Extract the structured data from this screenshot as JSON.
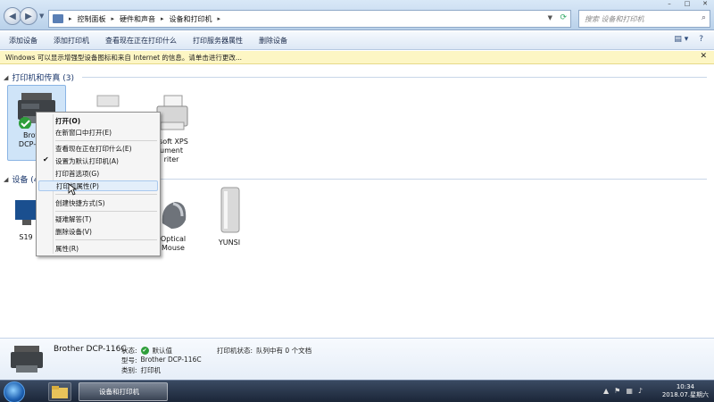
{
  "breadcrumb": [
    "控制面板",
    "硬件和声音",
    "设备和打印机"
  ],
  "search": {
    "placeholder": "搜索 设备和打印机"
  },
  "toolbar": [
    "添加设备",
    "添加打印机",
    "查看现在正在打印什么",
    "打印服务器属性",
    "删除设备"
  ],
  "infobar": {
    "text": "Windows 可以显示增强型设备图标和来自 Internet 的信息。请单击进行更改..."
  },
  "groups": {
    "printers": "打印机和传真 (3)",
    "devices": "设备 (4)"
  },
  "printers": [
    {
      "label_1": "Brother",
      "label_2": "DCP-116C"
    },
    {
      "label_1": "",
      "label_2": ""
    },
    {
      "label_1": "osoft XPS",
      "label_2": "ument",
      "label_3": "riter"
    }
  ],
  "devices": [
    {
      "label": "S19"
    },
    {
      "label_1": "Optical",
      "label_2": "Mouse"
    },
    {
      "label": "YUNSI"
    }
  ],
  "context_menu": [
    {
      "label": "打开(O)",
      "bold": true
    },
    {
      "label": "在新窗口中打开(E)"
    },
    {
      "sep": true
    },
    {
      "label": "查看现在正在打印什么(E)"
    },
    {
      "label": "设置为默认打印机(A)",
      "checked": true
    },
    {
      "label": "打印首选项(G)"
    },
    {
      "label": "打印机属性(P)",
      "highlighted": true
    },
    {
      "sep": true
    },
    {
      "label": "创建快捷方式(S)"
    },
    {
      "sep": true
    },
    {
      "label": "疑难解答(T)"
    },
    {
      "label": "删除设备(V)"
    },
    {
      "sep": true
    },
    {
      "label": "属性(R)"
    }
  ],
  "details": {
    "name": "Brother DCP-116C",
    "status_label": "状态:",
    "status_value": "默认值",
    "model_label": "型号:",
    "model_value": "Brother DCP-116C",
    "category_label": "类别:",
    "category_value": "打印机",
    "printer_status_label": "打印机状态:",
    "printer_status_value": "队列中有 0 个文档"
  },
  "taskbar": {
    "active_window": "设备和打印机",
    "time": "10:34",
    "date": "2018.07.星期六"
  },
  "colors": {
    "accent": "#1e3a6e",
    "highlight": "#cfe4f8",
    "infobar": "#fdf6c4"
  }
}
